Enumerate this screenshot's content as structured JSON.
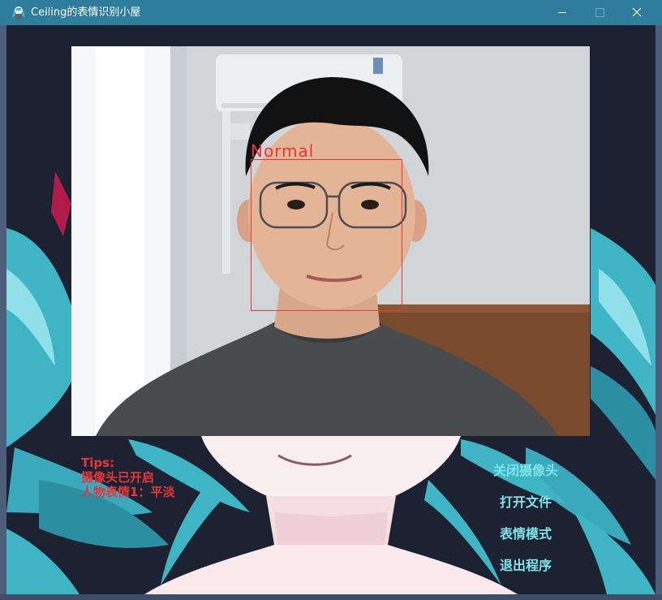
{
  "window": {
    "title": "Ceiling的表情识别小屋",
    "icon": "app-character-icon",
    "controls": [
      "minimize-icon",
      "maximize-icon",
      "close-icon"
    ]
  },
  "camera": {
    "detection_label": "Normal",
    "box_color": "#e8363a"
  },
  "tips": {
    "heading": "Tips:",
    "line1": "摄像头已开启",
    "line2": "人物表情1：平淡"
  },
  "menu": {
    "close_camera": "关闭摄像头",
    "open_file": "打开文件",
    "expression_mode": "表情模式",
    "exit": "退出程序"
  },
  "colors": {
    "titlebar": "#2f7d9c",
    "background": "#1c2232",
    "tips_text": "#e8363a",
    "menu_text": "#7fe3ea"
  }
}
